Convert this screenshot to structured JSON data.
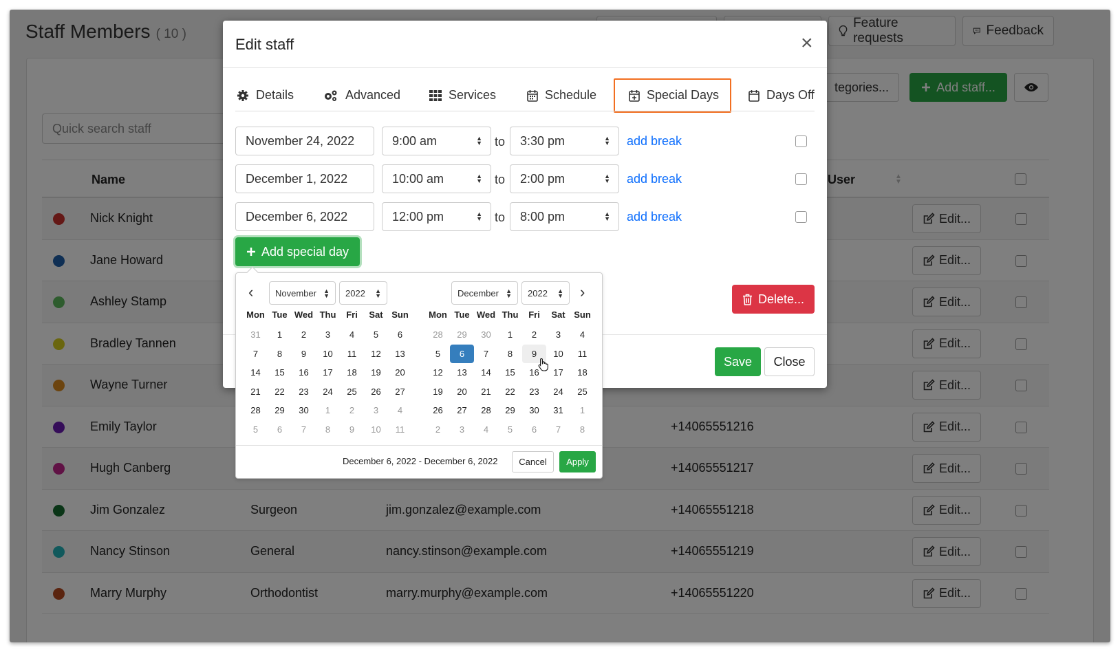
{
  "page": {
    "title": "Staff Members",
    "count": "( 10 )",
    "feature_requests": "Feature requests",
    "feedback": "Feedback",
    "categories_btn": "tegories...",
    "add_staff": "Add staff...",
    "search_placeholder": "Quick search staff"
  },
  "table": {
    "headers": {
      "name": "Name",
      "user": "User"
    },
    "edit_label": "Edit...",
    "rows": [
      {
        "name": "Nick Knight",
        "color": "#c9302c",
        "position": "",
        "email": "",
        "phone": ""
      },
      {
        "name": "Jane Howard",
        "color": "#1f5fa8",
        "position": "",
        "email": "",
        "phone": ""
      },
      {
        "name": "Ashley Stamp",
        "color": "#5cb85c",
        "position": "",
        "email": "",
        "phone": ""
      },
      {
        "name": "Bradley Tannen",
        "color": "#d4cc1c",
        "position": "",
        "email": "",
        "phone": ""
      },
      {
        "name": "Wayne Turner",
        "color": "#d9891f",
        "position": "",
        "email": "",
        "phone": ""
      },
      {
        "name": "Emily Taylor",
        "color": "#6a1bb3",
        "position": "",
        "email": "",
        "phone": "+14065551216"
      },
      {
        "name": "Hugh Canberg",
        "color": "#c0248a",
        "position": "",
        "email": "",
        "phone": "+14065551217"
      },
      {
        "name": "Jim Gonzalez",
        "color": "#146b2e",
        "position": "Surgeon",
        "email": "jim.gonzalez@example.com",
        "phone": "+14065551218"
      },
      {
        "name": "Nancy Stinson",
        "color": "#22b3b8",
        "position": "General",
        "email": "nancy.stinson@example.com",
        "phone": "+14065551219"
      },
      {
        "name": "Marry Murphy",
        "color": "#b4481f",
        "position": "Orthodontist",
        "email": "marry.murphy@example.com",
        "phone": "+14065551220"
      }
    ]
  },
  "modal": {
    "title": "Edit staff",
    "close": "×",
    "tabs": {
      "details": "Details",
      "advanced": "Advanced",
      "services": "Services",
      "schedule": "Schedule",
      "special_days": "Special Days",
      "days_off": "Days Off"
    },
    "special_days": [
      {
        "date": "November 24, 2022",
        "start": "9:00 am",
        "end": "3:30 pm"
      },
      {
        "date": "December 1, 2022",
        "start": "10:00 am",
        "end": "2:00 pm"
      },
      {
        "date": "December 6, 2022",
        "start": "12:00 pm",
        "end": "8:00 pm"
      }
    ],
    "to_label": "to",
    "add_break": "add break",
    "add_special_day": "Add special day",
    "delete": "Delete...",
    "save": "Save",
    "close_btn": "Close"
  },
  "datepicker": {
    "left": {
      "month": "November",
      "year": "2022"
    },
    "right": {
      "month": "December",
      "year": "2022"
    },
    "weekdays": [
      "Mon",
      "Tue",
      "Wed",
      "Thu",
      "Fri",
      "Sat",
      "Sun"
    ],
    "left_days": [
      [
        "31",
        "off"
      ],
      [
        "1",
        ""
      ],
      [
        "2",
        ""
      ],
      [
        "3",
        ""
      ],
      [
        "4",
        ""
      ],
      [
        "5",
        ""
      ],
      [
        "6",
        ""
      ],
      [
        "7",
        ""
      ],
      [
        "8",
        ""
      ],
      [
        "9",
        ""
      ],
      [
        "10",
        ""
      ],
      [
        "11",
        ""
      ],
      [
        "12",
        ""
      ],
      [
        "13",
        ""
      ],
      [
        "14",
        ""
      ],
      [
        "15",
        ""
      ],
      [
        "16",
        ""
      ],
      [
        "17",
        ""
      ],
      [
        "18",
        ""
      ],
      [
        "19",
        ""
      ],
      [
        "20",
        ""
      ],
      [
        "21",
        ""
      ],
      [
        "22",
        ""
      ],
      [
        "23",
        ""
      ],
      [
        "24",
        ""
      ],
      [
        "25",
        ""
      ],
      [
        "26",
        ""
      ],
      [
        "27",
        ""
      ],
      [
        "28",
        ""
      ],
      [
        "29",
        ""
      ],
      [
        "30",
        ""
      ],
      [
        "1",
        "off"
      ],
      [
        "2",
        "off"
      ],
      [
        "3",
        "off"
      ],
      [
        "4",
        "off"
      ],
      [
        "5",
        "off"
      ],
      [
        "6",
        "off"
      ],
      [
        "7",
        "off"
      ],
      [
        "8",
        "off"
      ],
      [
        "9",
        "off"
      ],
      [
        "10",
        "off"
      ],
      [
        "11",
        "off"
      ]
    ],
    "right_days": [
      [
        "28",
        "off"
      ],
      [
        "29",
        "off"
      ],
      [
        "30",
        "off"
      ],
      [
        "1",
        ""
      ],
      [
        "2",
        ""
      ],
      [
        "3",
        ""
      ],
      [
        "4",
        ""
      ],
      [
        "5",
        ""
      ],
      [
        "6",
        "sel"
      ],
      [
        "7",
        ""
      ],
      [
        "8",
        ""
      ],
      [
        "9",
        "hov"
      ],
      [
        "10",
        ""
      ],
      [
        "11",
        ""
      ],
      [
        "12",
        ""
      ],
      [
        "13",
        ""
      ],
      [
        "14",
        ""
      ],
      [
        "15",
        ""
      ],
      [
        "16",
        ""
      ],
      [
        "17",
        ""
      ],
      [
        "18",
        ""
      ],
      [
        "19",
        ""
      ],
      [
        "20",
        ""
      ],
      [
        "21",
        ""
      ],
      [
        "22",
        ""
      ],
      [
        "23",
        ""
      ],
      [
        "24",
        ""
      ],
      [
        "25",
        ""
      ],
      [
        "26",
        ""
      ],
      [
        "27",
        ""
      ],
      [
        "28",
        ""
      ],
      [
        "29",
        ""
      ],
      [
        "30",
        ""
      ],
      [
        "31",
        ""
      ],
      [
        "1",
        "off"
      ],
      [
        "2",
        "off"
      ],
      [
        "3",
        "off"
      ],
      [
        "4",
        "off"
      ],
      [
        "5",
        "off"
      ],
      [
        "6",
        "off"
      ],
      [
        "7",
        "off"
      ],
      [
        "8",
        "off"
      ]
    ],
    "range": "December 6, 2022 - December 6, 2022",
    "cancel": "Cancel",
    "apply": "Apply"
  },
  "colors": {
    "accent_green": "#28a745",
    "danger": "#dc3545",
    "highlight": "#f26f21",
    "selected_day": "#357ebd",
    "link": "#0d6efd"
  }
}
